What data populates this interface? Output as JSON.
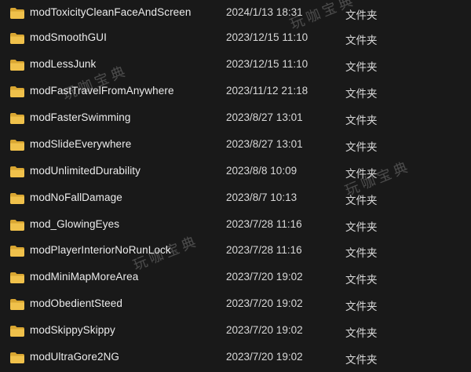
{
  "files": [
    {
      "name": "modToxicityCleanFaceAndScreen",
      "date": "2024/1/13 18:31",
      "type": "文件夹",
      "icon": "folder-icon"
    },
    {
      "name": "modSmoothGUI",
      "date": "2023/12/15 11:10",
      "type": "文件夹",
      "icon": "folder-icon"
    },
    {
      "name": "modLessJunk",
      "date": "2023/12/15 11:10",
      "type": "文件夹",
      "icon": "folder-icon"
    },
    {
      "name": "modFastTravelFromAnywhere",
      "date": "2023/11/12 21:18",
      "type": "文件夹",
      "icon": "folder-icon"
    },
    {
      "name": "modFasterSwimming",
      "date": "2023/8/27 13:01",
      "type": "文件夹",
      "icon": "folder-icon"
    },
    {
      "name": "modSlideEverywhere",
      "date": "2023/8/27 13:01",
      "type": "文件夹",
      "icon": "folder-icon"
    },
    {
      "name": "modUnlimitedDurability",
      "date": "2023/8/8 10:09",
      "type": "文件夹",
      "icon": "folder-icon"
    },
    {
      "name": "modNoFallDamage",
      "date": "2023/8/7 10:13",
      "type": "文件夹",
      "icon": "folder-icon"
    },
    {
      "name": "mod_GlowingEyes",
      "date": "2023/7/28 11:16",
      "type": "文件夹",
      "icon": "folder-icon"
    },
    {
      "name": "modPlayerInteriorNoRunLock",
      "date": "2023/7/28 11:16",
      "type": "文件夹",
      "icon": "folder-icon"
    },
    {
      "name": "modMiniMapMoreArea",
      "date": "2023/7/20 19:02",
      "type": "文件夹",
      "icon": "folder-icon"
    },
    {
      "name": "modObedientSteed",
      "date": "2023/7/20 19:02",
      "type": "文件夹",
      "icon": "folder-icon"
    },
    {
      "name": "modSkippySkippy",
      "date": "2023/7/20 19:02",
      "type": "文件夹",
      "icon": "folder-icon"
    },
    {
      "name": "modUltraGore2NG",
      "date": "2023/7/20 19:02",
      "type": "文件夹",
      "icon": "folder-icon"
    }
  ],
  "watermark": {
    "text": "玩咖宝典"
  },
  "colors": {
    "background": "#191919",
    "folder": "#f0c14b",
    "folder_dark": "#d9a632",
    "text": "#ececec"
  }
}
